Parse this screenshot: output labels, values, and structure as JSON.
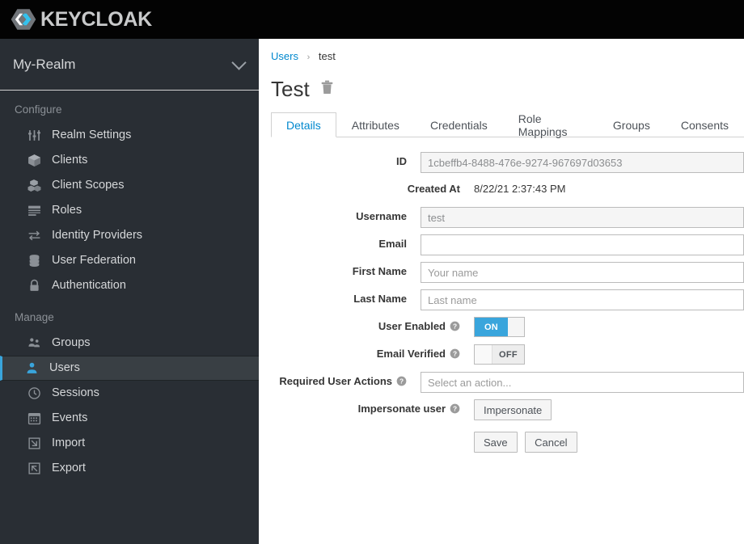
{
  "masthead": {
    "brand_text": "KEYCLOAK",
    "logo_icon": "keycloak-hexagon-logo",
    "background": "#030303",
    "brand_color": "#c8c9ca",
    "logo_accent": "#33c3f0"
  },
  "sidebar": {
    "realm": {
      "name": "My-Realm",
      "chevron_icon": "chevron-down-icon"
    },
    "sections": [
      {
        "title": "Configure",
        "items": [
          {
            "label": "Realm Settings",
            "icon": "sliders-icon",
            "active": false
          },
          {
            "label": "Clients",
            "icon": "cube-icon",
            "active": false
          },
          {
            "label": "Client Scopes",
            "icon": "cubes-icon",
            "active": false
          },
          {
            "label": "Roles",
            "icon": "list-rows-icon",
            "active": false
          },
          {
            "label": "Identity Providers",
            "icon": "exchange-arrows-icon",
            "active": false
          },
          {
            "label": "User Federation",
            "icon": "database-icon",
            "active": false
          },
          {
            "label": "Authentication",
            "icon": "lock-icon",
            "active": false
          }
        ]
      },
      {
        "title": "Manage",
        "items": [
          {
            "label": "Groups",
            "icon": "users-group-icon",
            "active": false
          },
          {
            "label": "Users",
            "icon": "user-icon",
            "active": true
          },
          {
            "label": "Sessions",
            "icon": "clock-icon",
            "active": false
          },
          {
            "label": "Events",
            "icon": "calendar-icon",
            "active": false
          },
          {
            "label": "Import",
            "icon": "import-arrow-icon",
            "active": false
          },
          {
            "label": "Export",
            "icon": "export-arrow-icon",
            "active": false
          }
        ]
      }
    ],
    "accent_color": "#39a5dc",
    "background": "#292e34",
    "active_background": "#393f44"
  },
  "breadcrumb": {
    "root": "Users",
    "separator": "›",
    "current": "test"
  },
  "page": {
    "title": "Test",
    "delete_icon": "trash-icon"
  },
  "tabs": [
    {
      "label": "Details",
      "active": true
    },
    {
      "label": "Attributes",
      "active": false
    },
    {
      "label": "Credentials",
      "active": false
    },
    {
      "label": "Role Mappings",
      "active": false
    },
    {
      "label": "Groups",
      "active": false
    },
    {
      "label": "Consents",
      "active": false
    }
  ],
  "form": {
    "id": {
      "label": "ID",
      "value": "1cbeffb4-8488-476e-9274-967697d03653",
      "disabled": true
    },
    "created_at": {
      "label": "Created At",
      "value": "8/22/21 2:37:43 PM"
    },
    "username": {
      "label": "Username",
      "value": "test",
      "disabled": true
    },
    "email": {
      "label": "Email",
      "value": "",
      "placeholder": ""
    },
    "first_name": {
      "label": "First Name",
      "value": "",
      "placeholder": "Your name"
    },
    "last_name": {
      "label": "Last Name",
      "value": "",
      "placeholder": "Last name"
    },
    "user_enabled": {
      "label": "User Enabled",
      "help_icon": "help-circle-icon",
      "state": "ON",
      "on_label": "ON",
      "off_label": "OFF"
    },
    "email_verified": {
      "label": "Email Verified",
      "help_icon": "help-circle-icon",
      "state": "OFF",
      "on_label": "ON",
      "off_label": "OFF"
    },
    "required_user_actions": {
      "label": "Required User Actions",
      "help_icon": "help-circle-icon",
      "value": "",
      "placeholder": "Select an action..."
    },
    "impersonate_user": {
      "label": "Impersonate user",
      "help_icon": "help-circle-icon",
      "button_label": "Impersonate"
    },
    "save_label": "Save",
    "cancel_label": "Cancel"
  }
}
